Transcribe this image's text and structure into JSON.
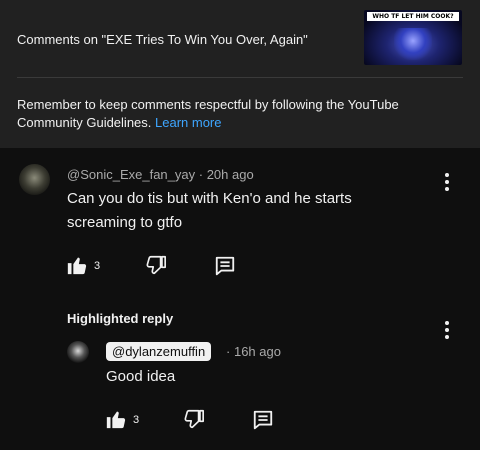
{
  "header": {
    "title": "Comments on \"EXE Tries To Win You Over, Again\"",
    "thumbnail_banner": "WHO TF LET HIM COOK?"
  },
  "guidelines": {
    "text": "Remember to keep comments respectful by following the YouTube Community Guidelines.",
    "link": "Learn more"
  },
  "comment": {
    "author": "@Sonic_Exe_fan_yay",
    "time": "20h ago",
    "separator": "·",
    "text": "Can you do tis but with Ken'o and he starts screaming to gtfo",
    "likes": "3"
  },
  "reply_section": {
    "label": "Highlighted reply"
  },
  "reply": {
    "author": "@dylanzemuffin",
    "separator": "·",
    "time": "16h ago",
    "text": "Good idea",
    "likes": "3"
  },
  "icons": {
    "like": "thumbs-up-icon",
    "dislike": "thumbs-down-icon",
    "reply": "comment-icon",
    "more": "vertical-dots-icon"
  },
  "colors": {
    "background": "#0f0f0f",
    "header": "#212121",
    "link": "#3ea6ff",
    "secondary_text": "#aaaaaa"
  }
}
